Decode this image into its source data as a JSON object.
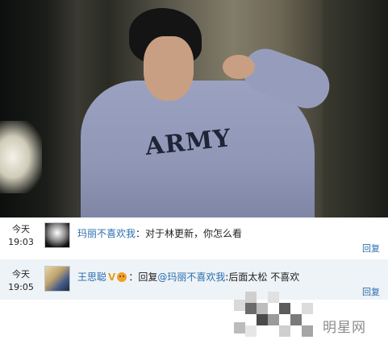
{
  "photo": {
    "shirt_text": "ARMY"
  },
  "comments": [
    {
      "time_day": "今天",
      "time_clock": "19:03",
      "author": "玛丽不喜欢我",
      "separator": "：",
      "text": "对于林更新，你怎么看",
      "reply_label": "回复"
    },
    {
      "time_day": "今天",
      "time_clock": "19:05",
      "author": "王思聪",
      "badge": "V",
      "separator": "：",
      "reply_prefix": "回复",
      "mention": "@玛丽不喜欢我",
      "text": ":后面太松 不喜欢",
      "reply_label": "回复"
    }
  ],
  "watermark": {
    "text": "明星网"
  },
  "colors": {
    "link": "#2a6cae",
    "highlight_row": "#eef3f7",
    "vip": "#e4a11b"
  }
}
